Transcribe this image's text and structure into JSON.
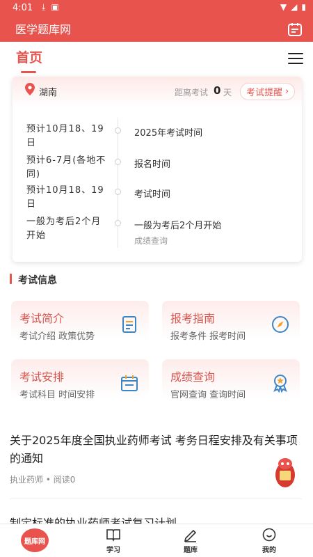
{
  "status": {
    "time": "4:01"
  },
  "app": {
    "brand": "医学题库网"
  },
  "header": {
    "tab": "首页"
  },
  "card": {
    "location": "湖南",
    "countdown_label": "距离考试",
    "countdown_days": "0",
    "countdown_unit": "天",
    "remind_label": "考试提醒",
    "rows": [
      {
        "date": "预计10月18、19日",
        "event": "2025年考试时间",
        "sub": ""
      },
      {
        "date": "预计6-7月(各地不同)",
        "event": "报名时间",
        "sub": ""
      },
      {
        "date": "预计10月18、19日",
        "event": "考试时间",
        "sub": ""
      },
      {
        "date": "一般为考后2个月开始",
        "event": "一般为考后2个月开始",
        "sub": "成绩查询"
      }
    ]
  },
  "section": {
    "title": "考试信息"
  },
  "tiles": [
    {
      "title": "考试简介",
      "sub": "考试介绍 政策优势"
    },
    {
      "title": "报考指南",
      "sub": "报考条件 报考时间"
    },
    {
      "title": "考试安排",
      "sub": "考试科目 时间安排"
    },
    {
      "title": "成绩查询",
      "sub": "官网查询 查询时间"
    }
  ],
  "article": {
    "title": "关于2025年度全国执业药师考试 考务日程安排及有关事项的通知",
    "category": "执业药师",
    "reads": "阅读0",
    "next_title": "制定标准的执业药师考试复习计划"
  },
  "nav": {
    "logo": "题库网",
    "items": [
      {
        "label": "学习"
      },
      {
        "label": "题库"
      },
      {
        "label": "我的"
      }
    ]
  },
  "colors": {
    "accent": "#e8544d"
  }
}
